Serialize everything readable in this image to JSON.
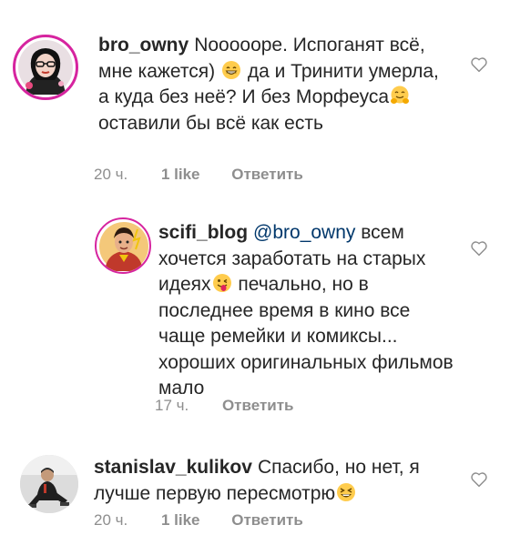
{
  "comments": [
    {
      "username": "bro_owny",
      "text_parts": [
        "Nooooope. Испоганят всё, мне кажется)",
        "да и Тринити умерла, а куда без неё? И без Морфеуса",
        "оставили бы всё как есть"
      ],
      "emojis": [
        "grinning-smiling-eyes-emoji",
        "smiling-hands-emoji"
      ],
      "time": "20 ч.",
      "likes": "1 like",
      "reply": "Ответить",
      "avatar": "avatar-woman-glasses"
    },
    {
      "username": "scifi_blog",
      "mention": "@bro_owny",
      "text_parts": [
        "всем хочется заработать на старых идеях",
        "печально, но в последнее время в кино все чаще ремейки и комиксы... хороших оригинальных фильмов мало"
      ],
      "emojis": [
        "winking-tongue-emoji"
      ],
      "time": "17 ч.",
      "reply": "Ответить",
      "avatar": "avatar-superhero"
    },
    {
      "username": "stanislav_kulikov",
      "text_parts": [
        "Спасибо, но нет, я лучше первую пересмотрю"
      ],
      "emojis": [
        "laughing-emoji"
      ],
      "time": "20 ч.",
      "likes": "1 like",
      "reply": "Ответить",
      "avatar": "avatar-man-sitting"
    }
  ],
  "colors": {
    "text": "#262626",
    "secondary": "#8e8e8e",
    "mention": "#00376b",
    "emoji_face": "#ffcc4d",
    "story_ring": "#d6249f"
  }
}
